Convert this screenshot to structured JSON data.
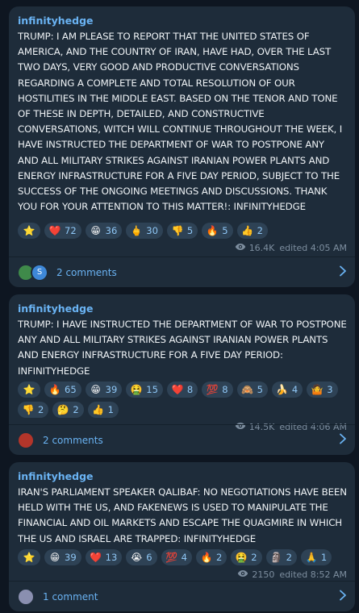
{
  "posts": [
    {
      "author": "infinityhedge",
      "text": "TRUMP: I AM PLEASE TO REPORT THAT THE UNITED STATES OF AMERICA, AND THE COUNTRY OF IRAN, HAVE HAD, OVER THE LAST TWO DAYS, VERY GOOD AND PRODUCTIVE CONVERSATIONS REGARDING A COMPLETE AND TOTAL RESOLUTION OF OUR HOSTILITIES IN THE MIDDLE EAST. BASED ON THE TENOR AND TONE OF THESE IN DEPTH, DETAILED, AND CONSTRUCTIVE CONVERSATIONS, WITCH WILL CONTINUE THROUGHOUT THE WEEK, I HAVE INSTRUCTED THE DEPARTMENT OF WAR TO POSTPONE ANY AND ALL MILITARY STRIKES AGAINST IRANIAN POWER PLANTS AND ENERGY INFRASTRUCTURE FOR A FIVE DAY PERIOD, SUBJECT TO THE SUCCESS OF THE ONGOING MEETINGS AND DISCUSSIONS. THANK YOU FOR YOUR ATTENTION TO THIS MATTER!: INFINITYHEDGE",
      "reactions": [
        {
          "emoji": "⭐",
          "count": ""
        },
        {
          "emoji": "❤️",
          "count": "72"
        },
        {
          "emoji": "😁",
          "count": "36"
        },
        {
          "emoji": "🖕",
          "count": "30"
        },
        {
          "emoji": "👎",
          "count": "5"
        },
        {
          "emoji": "🔥",
          "count": "5"
        },
        {
          "emoji": "👍",
          "count": "2"
        }
      ],
      "views": "16.4K",
      "edited": "edited 4:05 AM",
      "comments": "2 comments",
      "avatars": [
        {
          "label": "",
          "color": "#3f8a4a",
          "icon": "frog-avatar"
        },
        {
          "label": "S",
          "color": "#3e88d8",
          "icon": "letter-avatar"
        }
      ]
    },
    {
      "author": "infinityhedge",
      "text": "TRUMP: I HAVE INSTRUCTED THE DEPARTMENT OF WAR TO POSTPONE ANY AND ALL MILITARY STRIKES AGAINST IRANIAN POWER PLANTS AND ENERGY INFRASTRUCTURE FOR A FIVE DAY PERIOD: INFINITYHEDGE",
      "reactions": [
        {
          "emoji": "⭐",
          "count": ""
        },
        {
          "emoji": "🔥",
          "count": "65"
        },
        {
          "emoji": "😁",
          "count": "39"
        },
        {
          "emoji": "🤮",
          "count": "15"
        },
        {
          "emoji": "❤️",
          "count": "8"
        },
        {
          "emoji": "💯",
          "count": "8"
        },
        {
          "emoji": "🙈",
          "count": "5"
        },
        {
          "emoji": "🍌",
          "count": "4"
        },
        {
          "emoji": "🤷",
          "count": "3"
        },
        {
          "emoji": "👎",
          "count": "2"
        },
        {
          "emoji": "🤔",
          "count": "2"
        },
        {
          "emoji": "👍",
          "count": "1"
        }
      ],
      "views": "14.5K",
      "edited": "edited 4:06 AM",
      "comments": "2 comments",
      "avatars": [
        {
          "label": "",
          "color": "#b3352a",
          "icon": "user-avatar"
        }
      ]
    },
    {
      "author": "infinityhedge",
      "text": "IRAN'S PARLIAMENT SPEAKER QALIBAF: NO NEGOTIATIONS HAVE BEEN HELD WITH THE US, AND FAKENEWS IS USED TO MANIPULATE THE FINANCIAL AND OIL MARKETS AND ESCAPE THE QUAGMIRE IN WHICH THE US AND ISRAEL ARE TRAPPED: INFINITYHEDGE",
      "reactions": [
        {
          "emoji": "⭐",
          "count": ""
        },
        {
          "emoji": "😁",
          "count": "39"
        },
        {
          "emoji": "❤️",
          "count": "13"
        },
        {
          "emoji": "😭",
          "count": "6"
        },
        {
          "emoji": "💯",
          "count": "4"
        },
        {
          "emoji": "🔥",
          "count": "2"
        },
        {
          "emoji": "🤮",
          "count": "2"
        },
        {
          "emoji": "🗿",
          "count": "2"
        },
        {
          "emoji": "🙏",
          "count": "1"
        }
      ],
      "views": "2150",
      "edited": "edited 8:52 AM",
      "comments": "1 comment",
      "avatars": [
        {
          "label": "",
          "color": "#8a8fb0",
          "icon": "robot-avatar"
        }
      ]
    }
  ]
}
